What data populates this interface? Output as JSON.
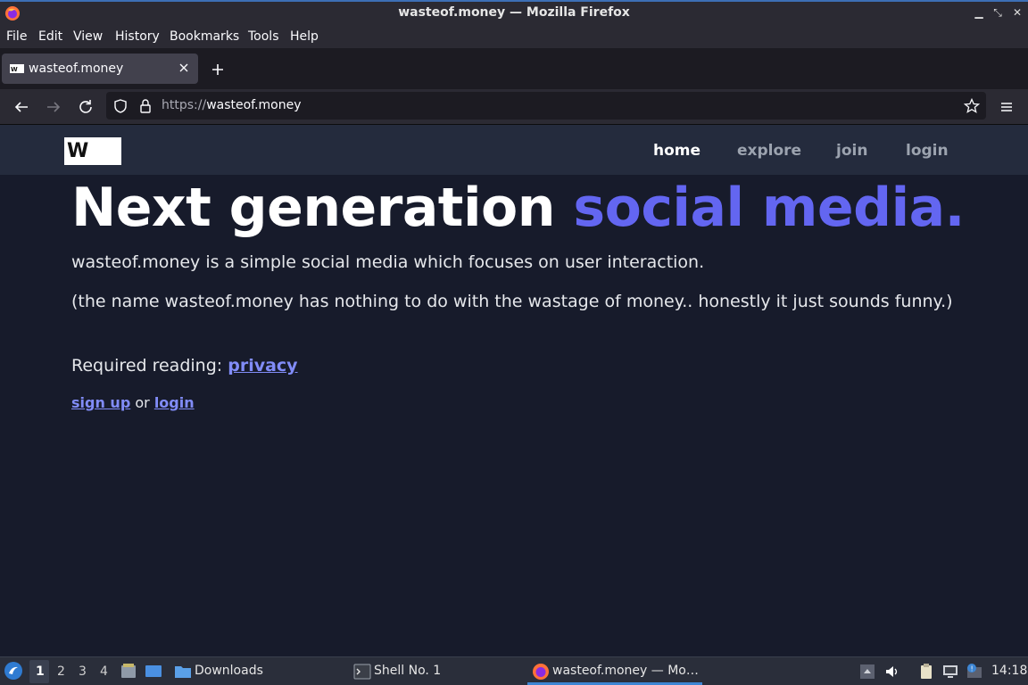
{
  "window": {
    "title": "wasteof.money — Mozilla Firefox"
  },
  "menubar": {
    "items": [
      "File",
      "Edit",
      "View",
      "History",
      "Bookmarks",
      "Tools",
      "Help"
    ]
  },
  "tabs": [
    {
      "title": "wasteof.money"
    }
  ],
  "urlbar": {
    "scheme": "https://",
    "host": "wasteof.money"
  },
  "site": {
    "logo_text": "W",
    "nav": [
      {
        "label": "home",
        "active": true
      },
      {
        "label": "explore",
        "active": false
      },
      {
        "label": "join",
        "active": false
      },
      {
        "label": "login",
        "active": false
      }
    ],
    "hero": {
      "text": "Next generation ",
      "accent": "social media."
    },
    "intro": "wasteof.money is a simple social media which focuses on user interaction.",
    "note": "(the name wasteof.money has nothing to do with the wastage of money.. honestly it just sounds funny.)",
    "required_reading": {
      "label": "Required reading: ",
      "link": "privacy"
    },
    "cta": {
      "signup": "sign up",
      "or": " or ",
      "login": "login"
    }
  },
  "taskbar": {
    "workspaces": [
      "1",
      "2",
      "3",
      "4"
    ],
    "active_workspace": "1",
    "tasks": [
      {
        "label": "Downloads",
        "icon": "folder-icon"
      },
      {
        "label": "Shell No. 1",
        "icon": "terminal-icon"
      },
      {
        "label": "wasteof.money — Mo…",
        "icon": "firefox-icon"
      }
    ],
    "clock": "14:18"
  },
  "colors": {
    "accent": "#6366f1",
    "link": "#818cf8",
    "page_bg": "#171b2b",
    "header_bg": "#242b3d"
  }
}
